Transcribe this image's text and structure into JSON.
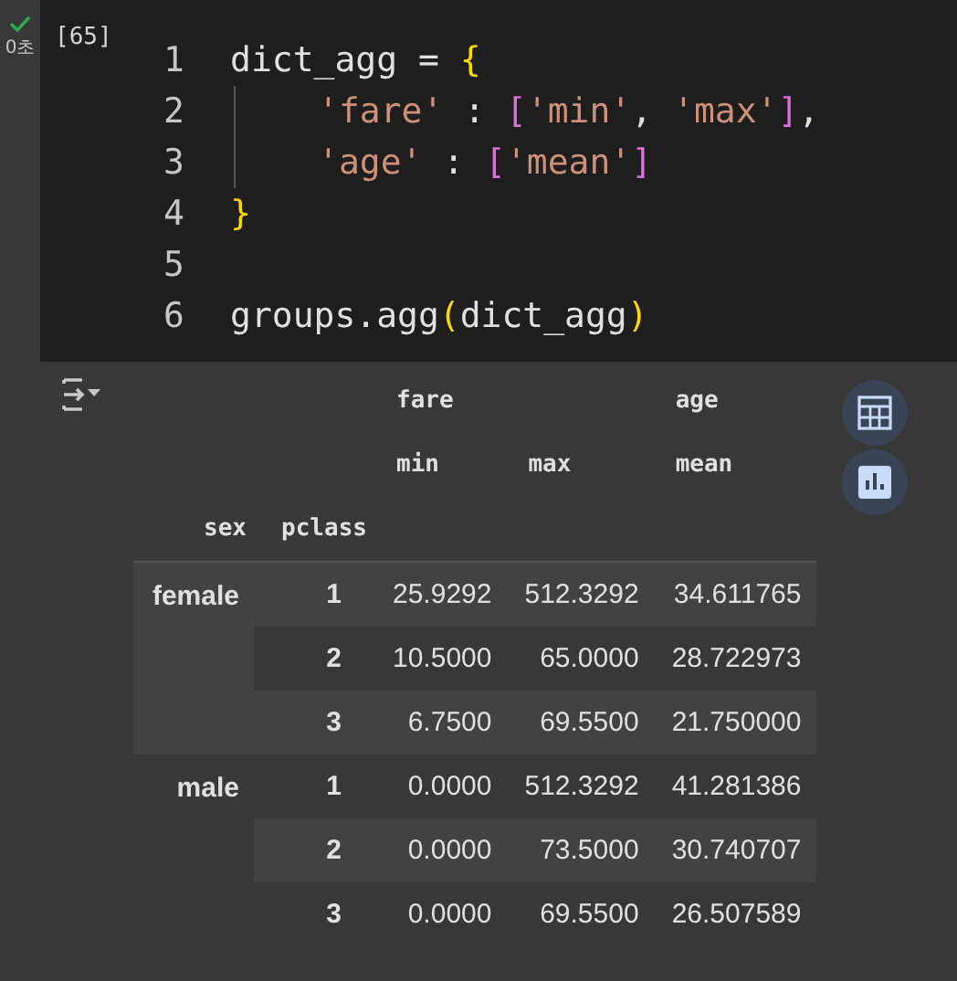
{
  "cell": {
    "status": "0초",
    "execution_count": "[65]",
    "lines": [
      {
        "number": "1",
        "indented": false,
        "tokens": [
          {
            "kind": "ident",
            "text": "dict_agg"
          },
          {
            "kind": "punct",
            "text": " = "
          },
          {
            "kind": "bracket1",
            "text": "{"
          }
        ]
      },
      {
        "number": "2",
        "indented": true,
        "tokens": [
          {
            "kind": "string",
            "text": "'fare'"
          },
          {
            "kind": "punct",
            "text": " : "
          },
          {
            "kind": "bracket2",
            "text": "["
          },
          {
            "kind": "string",
            "text": "'min'"
          },
          {
            "kind": "punct",
            "text": ", "
          },
          {
            "kind": "string",
            "text": "'max'"
          },
          {
            "kind": "bracket2",
            "text": "]"
          },
          {
            "kind": "punct",
            "text": ","
          }
        ]
      },
      {
        "number": "3",
        "indented": true,
        "tokens": [
          {
            "kind": "string",
            "text": "'age'"
          },
          {
            "kind": "punct",
            "text": " : "
          },
          {
            "kind": "bracket2",
            "text": "["
          },
          {
            "kind": "string",
            "text": "'mean'"
          },
          {
            "kind": "bracket2",
            "text": "]"
          }
        ]
      },
      {
        "number": "4",
        "indented": false,
        "tokens": [
          {
            "kind": "bracket1",
            "text": "}"
          }
        ]
      },
      {
        "number": "5",
        "indented": false
      },
      {
        "number": "6",
        "indented": false,
        "tokens": [
          {
            "kind": "ident",
            "text": "groups.agg"
          },
          {
            "kind": "bracket1",
            "text": "("
          },
          {
            "kind": "ident",
            "text": "dict_agg"
          },
          {
            "kind": "bracket1",
            "text": ")"
          }
        ]
      }
    ]
  },
  "output": {
    "table": {
      "column_groups": [
        {
          "name": "fare",
          "stats": [
            "min",
            "max"
          ]
        },
        {
          "name": "age",
          "stats": [
            "mean"
          ]
        }
      ],
      "index_names": [
        "sex",
        "pclass"
      ],
      "groups": [
        {
          "sex": "female",
          "rows": [
            {
              "pclass": "1",
              "values": [
                "25.9292",
                "512.3292",
                "34.611765"
              ]
            },
            {
              "pclass": "2",
              "values": [
                "10.5000",
                "65.0000",
                "28.722973"
              ]
            },
            {
              "pclass": "3",
              "values": [
                "6.7500",
                "69.5500",
                "21.750000"
              ]
            }
          ]
        },
        {
          "sex": "male",
          "rows": [
            {
              "pclass": "1",
              "values": [
                "0.0000",
                "512.3292",
                "41.281386"
              ]
            },
            {
              "pclass": "2",
              "values": [
                "0.0000",
                "73.5000",
                "30.740707"
              ]
            },
            {
              "pclass": "3",
              "values": [
                "0.0000",
                "69.5500",
                "26.507589"
              ]
            }
          ]
        }
      ]
    }
  }
}
